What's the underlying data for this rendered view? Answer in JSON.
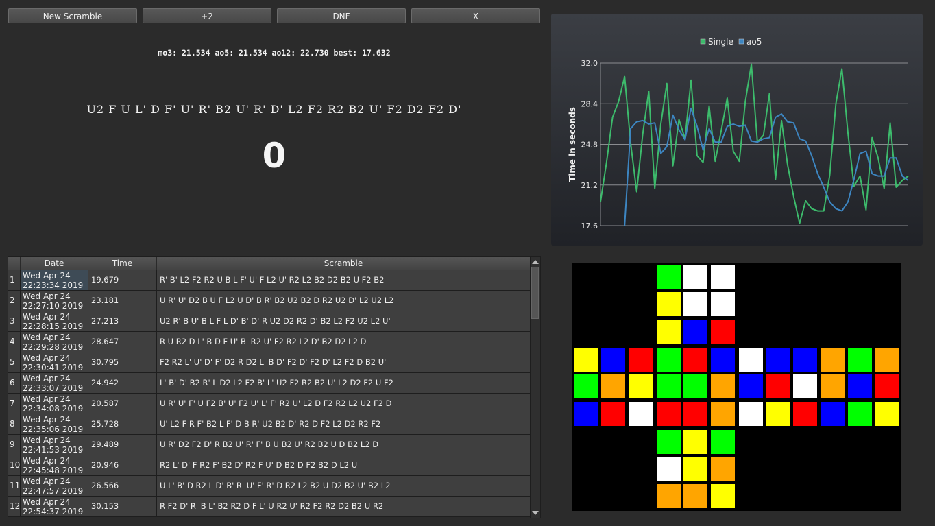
{
  "toolbar": {
    "new_scramble": "New Scramble",
    "plus_two": "+2",
    "dnf": "DNF",
    "x": "X"
  },
  "stats_line": "mo3: 21.534 ao5: 21.534 ao12: 22.730 best: 17.632",
  "scramble": "U2 F U L' D F' U' R' B2 U' R' D' L2 F2 R2 B2 U' F2 D2 F2 D'",
  "timer": "0",
  "chart_data": {
    "type": "line",
    "title": "",
    "xlabel": "",
    "ylabel": "Time in seconds",
    "ylim": [
      17.6,
      32.0
    ],
    "yticks": [
      "32.0",
      "28.4",
      "24.8",
      "21.2",
      "17.6"
    ],
    "legend_position": "top",
    "grid": true,
    "series": [
      {
        "name": "Single",
        "color": "#3dbb6c",
        "values": [
          19.7,
          23.2,
          27.2,
          28.6,
          30.8,
          24.9,
          20.6,
          25.7,
          29.5,
          20.9,
          26.6,
          30.2,
          22.9,
          27.0,
          25.3,
          30.5,
          23.8,
          23.2,
          28.2,
          23.3,
          26.0,
          28.9,
          24.2,
          23.3,
          28.6,
          31.9,
          25.0,
          25.6,
          29.3,
          21.7,
          26.9,
          23.0,
          20.2,
          17.8,
          19.8,
          19.1,
          18.9,
          18.9,
          22.1,
          28.4,
          31.5,
          25.8,
          21.1,
          22.0,
          19.0,
          25.4,
          23.6,
          20.9,
          26.7,
          21.0,
          21.6,
          22.0
        ]
      },
      {
        "name": "ao5",
        "color": "#3d86c2",
        "values": [
          null,
          null,
          null,
          null,
          17.6,
          26.2,
          26.8,
          26.9,
          26.6,
          26.7,
          24.0,
          24.6,
          27.4,
          26.1,
          25.2,
          28.0,
          26.4,
          24.3,
          26.2,
          25.0,
          25.0,
          26.4,
          26.6,
          26.4,
          26.5,
          25.1,
          25.0,
          25.3,
          25.4,
          27.2,
          27.5,
          26.8,
          26.7,
          25.3,
          25.1,
          23.8,
          22.2,
          21.0,
          19.7,
          19.1,
          18.9,
          19.7,
          21.7,
          24.0,
          24.2,
          22.2,
          22.0,
          22.0,
          23.6,
          23.6,
          22.0,
          21.6
        ]
      }
    ]
  },
  "table": {
    "headers": [
      "Date",
      "Time",
      "Scramble"
    ],
    "rows": [
      {
        "n": "1",
        "date1": "Wed Apr 24",
        "date2": "22:23:34 2019",
        "time": "19.679",
        "scramble": "R' B' L2 F2 R2 U B L F' U' F L2 U' R2 L2 B2 D2 B2 U F2 B2"
      },
      {
        "n": "2",
        "date1": "Wed Apr 24",
        "date2": "22:27:10 2019",
        "time": "23.181",
        "scramble": "U R' U' D2 B U F L2 U D' B R' B2 U2 B2 D R2 U2 D' L2 U2 L2"
      },
      {
        "n": "3",
        "date1": "Wed Apr 24",
        "date2": "22:28:15 2019",
        "time": "27.213",
        "scramble": "U2 R' B U' B L F L D' B' D' R U2 D2 R2 D' B2 L2 F2 U2 L2 U'"
      },
      {
        "n": "4",
        "date1": "Wed Apr 24",
        "date2": "22:29:28 2019",
        "time": "28.647",
        "scramble": "R U R2 D L' B D F U' B' R2 U' F2 R2 L2 D' B2 D2 L2 D"
      },
      {
        "n": "5",
        "date1": "Wed Apr 24",
        "date2": "22:30:41 2019",
        "time": "30.795",
        "scramble": "F2 R2 L' U' D' F' D2 R D2 L' B D' F2 D' F2 D' L2 F2 D B2 U'"
      },
      {
        "n": "6",
        "date1": "Wed Apr 24",
        "date2": "22:33:07 2019",
        "time": "24.942",
        "scramble": "L' B' D' B2 R' L D2 L2 F2 B' L' U2 F2 R2 B2 U' L2 D2 F2 U F2"
      },
      {
        "n": "7",
        "date1": "Wed Apr 24",
        "date2": "22:34:08 2019",
        "time": "20.587",
        "scramble": "U R' U' F' U F2 B' U' F2 U' L' F' R2 U' L2 D F2 R2 L2 U2 F2 D"
      },
      {
        "n": "8",
        "date1": "Wed Apr 24",
        "date2": "22:35:06 2019",
        "time": "25.728",
        "scramble": "U' L2 F R F' B2 L F' D B R' U2 B2 D' R2 D F2 L2 D2 R2 F2"
      },
      {
        "n": "9",
        "date1": "Wed Apr 24",
        "date2": "22:41:53 2019",
        "time": "29.489",
        "scramble": "U R' D2 F2 D' R B2 U' R' F' B U B2 U' R2 B2 U D B2 L2 D"
      },
      {
        "n": "10",
        "date1": "Wed Apr 24",
        "date2": "22:45:48 2019",
        "time": "20.946",
        "scramble": "R2 L' D' F R2 F' B2 D' R2 F U' D B2 D F2 B2 D L2 U"
      },
      {
        "n": "11",
        "date1": "Wed Apr 24",
        "date2": "22:47:57 2019",
        "time": "26.566",
        "scramble": "U L' B' D R2 L D' B' R' U' F' R' D R2 L2 B2 U D2 B2 U' B2 L2"
      },
      {
        "n": "12",
        "date1": "Wed Apr 24",
        "date2": "22:54:37 2019",
        "time": "30.153",
        "scramble": "R F2 D' R' B L' B2 R2 D F L' U R2 U' R2 F2 R2 D2 B2 U R2"
      }
    ]
  },
  "cube": {
    "colors": {
      "W": "#ffffff",
      "Y": "#ffff00",
      "R": "#ff0000",
      "O": "#ffa500",
      "B": "#0000ff",
      "G": "#00ff00"
    },
    "faces": {
      "up": [
        "G",
        "W",
        "W",
        "Y",
        "W",
        "W",
        "Y",
        "B",
        "R"
      ],
      "left": [
        "Y",
        "B",
        "R",
        "G",
        "O",
        "Y",
        "B",
        "R",
        "W"
      ],
      "front": [
        "G",
        "R",
        "B",
        "G",
        "G",
        "O",
        "R",
        "R",
        "O"
      ],
      "right": [
        "W",
        "B",
        "B",
        "B",
        "R",
        "W",
        "W",
        "Y",
        "R"
      ],
      "back": [
        "O",
        "G",
        "O",
        "O",
        "B",
        "R",
        "B",
        "G",
        "Y"
      ],
      "down": [
        "G",
        "Y",
        "G",
        "W",
        "Y",
        "O",
        "O",
        "O",
        "Y"
      ]
    }
  }
}
